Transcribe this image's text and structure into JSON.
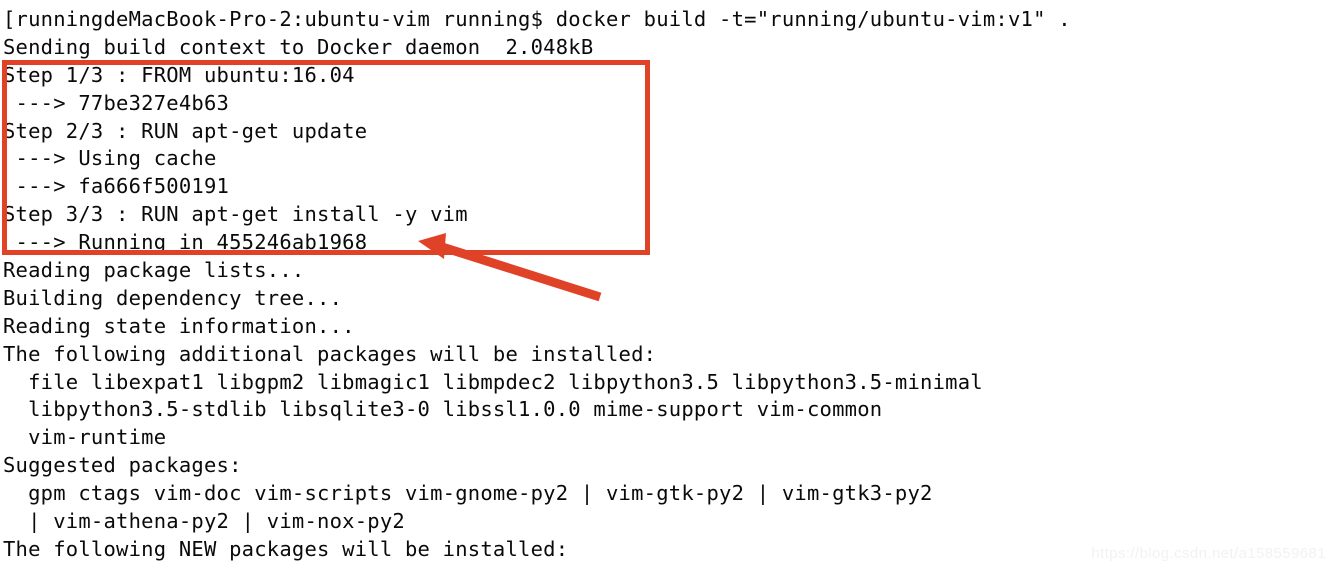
{
  "terminal": {
    "lines": [
      "[runningdeMacBook-Pro-2:ubuntu-vim running$ docker build -t=\"running/ubuntu-vim:v1\" .",
      "Sending build context to Docker daemon  2.048kB",
      "Step 1/3 : FROM ubuntu:16.04",
      " ---> 77be327e4b63",
      "Step 2/3 : RUN apt-get update",
      " ---> Using cache",
      " ---> fa666f500191",
      "Step 3/3 : RUN apt-get install -y vim",
      " ---> Running in 455246ab1968",
      "Reading package lists...",
      "Building dependency tree...",
      "Reading state information...",
      "The following additional packages will be installed:",
      "  file libexpat1 libgpm2 libmagic1 libmpdec2 libpython3.5 libpython3.5-minimal",
      "  libpython3.5-stdlib libsqlite3-0 libssl1.0.0 mime-support vim-common",
      "  vim-runtime",
      "Suggested packages:",
      "  gpm ctags vim-doc vim-scripts vim-gnome-py2 | vim-gtk-py2 | vim-gtk3-py2",
      "  | vim-athena-py2 | vim-nox-py2",
      "The following NEW packages will be installed:"
    ]
  },
  "annotations": {
    "highlight_color": "#e04228",
    "arrow_color": "#e04228",
    "highlight_label": "docker-build-steps-highlight",
    "arrow_label": "running-container-id-arrow"
  },
  "watermark": {
    "text": "https://blog.csdn.net/a158559681",
    "color": "#f2f2f2"
  }
}
